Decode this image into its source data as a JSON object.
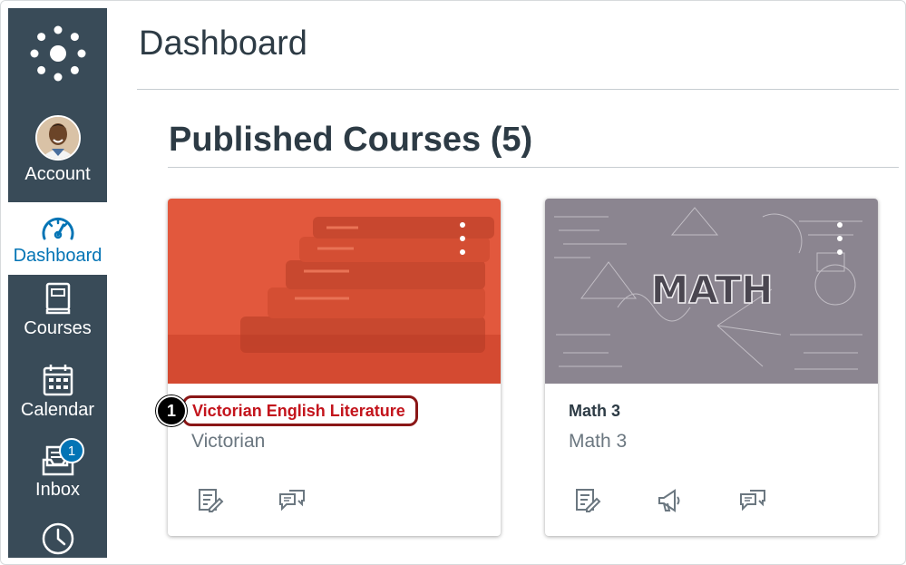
{
  "page": {
    "title": "Dashboard"
  },
  "sidebar": {
    "items": [
      {
        "label": "Account",
        "icon": "avatar"
      },
      {
        "label": "Dashboard",
        "icon": "dashboard-icon",
        "active": true
      },
      {
        "label": "Courses",
        "icon": "courses-icon"
      },
      {
        "label": "Calendar",
        "icon": "calendar-icon"
      },
      {
        "label": "Inbox",
        "icon": "inbox-icon",
        "badge": "1"
      },
      {
        "label": "",
        "icon": "history-icon"
      }
    ]
  },
  "section": {
    "title": "Published Courses (5)"
  },
  "courses": [
    {
      "title": "Victorian English Literature",
      "subtitle": "Victorian",
      "hero_color": "#e2583d",
      "hero_image": "books",
      "actions": [
        "assignments-icon",
        "discussions-icon"
      ],
      "highlighted": true
    },
    {
      "title": "Math 3",
      "subtitle": "Math 3",
      "hero_color": "#8b8590",
      "hero_image": "math-chalkboard",
      "hero_text": "MATH",
      "actions": [
        "assignments-icon",
        "announcements-icon",
        "discussions-icon"
      ]
    }
  ],
  "callout": {
    "number": "1"
  },
  "colors": {
    "sidebar": "#394b58",
    "accent": "#0374b5",
    "highlight_border": "#8a1616",
    "highlight_text": "#c3141c"
  }
}
